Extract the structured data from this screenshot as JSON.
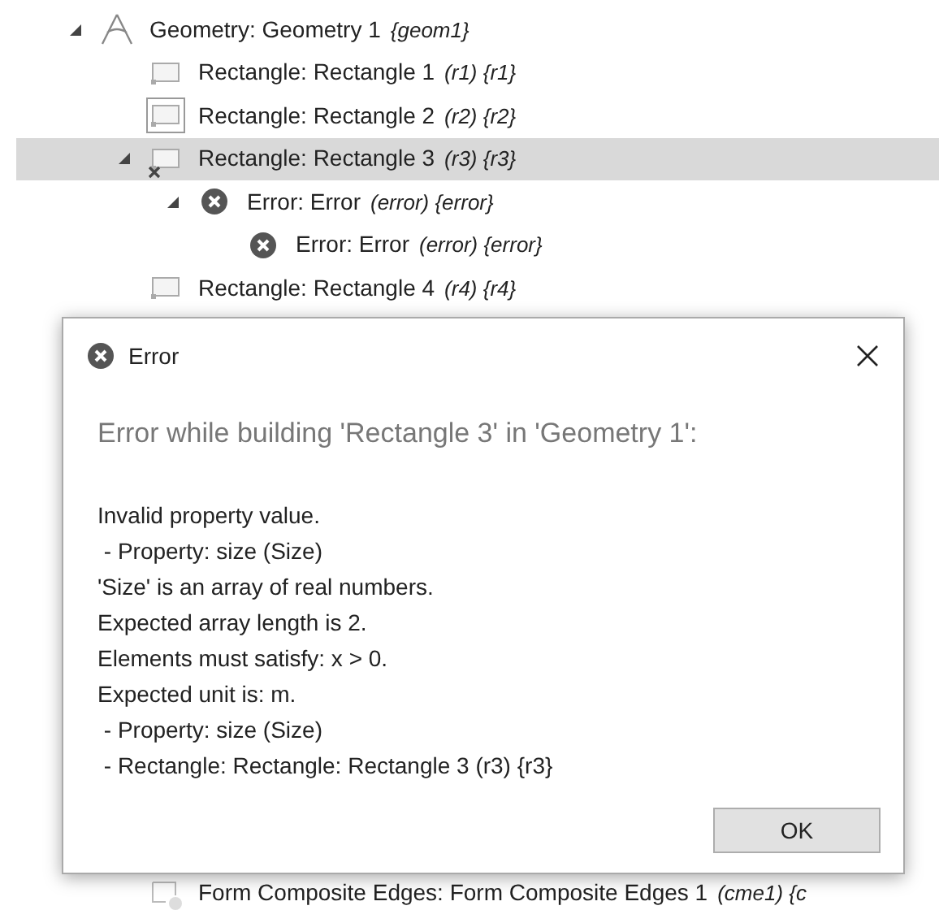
{
  "tree": [
    {
      "kind": "geometry",
      "label": "Geometry: Geometry 1",
      "ref": "{geom1}",
      "expanded": true,
      "selected": false,
      "children": [
        {
          "kind": "rectangle",
          "label": "Rectangle: Rectangle 1",
          "ref": "(r1) {r1}",
          "framed": false,
          "has_error": false,
          "selected": false
        },
        {
          "kind": "rectangle",
          "label": "Rectangle: Rectangle 2",
          "ref": "(r2) {r2}",
          "framed": true,
          "has_error": false,
          "selected": false
        },
        {
          "kind": "rectangle",
          "label": "Rectangle: Rectangle 3",
          "ref": "(r3) {r3}",
          "framed": false,
          "has_error": true,
          "selected": true,
          "expanded": true,
          "children": [
            {
              "kind": "error",
              "label": "Error: Error",
              "ref": "(error) {error}",
              "selected": false,
              "expanded": true,
              "children": [
                {
                  "kind": "error",
                  "label": "Error: Error",
                  "ref": "(error) {error}",
                  "selected": false
                }
              ]
            }
          ]
        },
        {
          "kind": "rectangle",
          "label": "Rectangle: Rectangle 4",
          "ref": "(r4) {r4}",
          "framed": false,
          "has_error": false,
          "selected": false
        },
        {
          "kind": "composite",
          "label": "Form Composite Edges: Form Composite Edges 1",
          "ref": "(cme1) {c",
          "selected": false
        }
      ]
    }
  ],
  "dialog": {
    "title": "Error",
    "heading": "Error while building 'Rectangle 3' in 'Geometry 1':",
    "lines": [
      "Invalid property value.",
      " - Property: size (Size)",
      "'Size' is an array of real numbers.",
      "Expected array length is 2.",
      "Elements must satisfy: x > 0.",
      "Expected unit is: m.",
      " - Property: size (Size)",
      " - Rectangle: Rectangle: Rectangle 3 (r3) {r3}"
    ],
    "buttons": [
      "OK"
    ]
  }
}
